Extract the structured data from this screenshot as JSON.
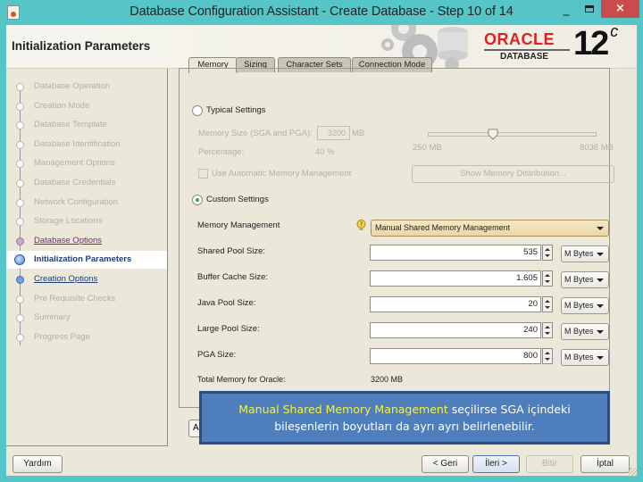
{
  "window": {
    "title": "Database Configuration Assistant - Create Database - Step 10 of 14",
    "minimize_glyph": "_",
    "close_glyph": "×",
    "icon": "java-app-icon"
  },
  "header": {
    "page_title": "Initialization Parameters",
    "brand_name": "ORACLE",
    "brand_sub": "DATABASE",
    "version": "12",
    "version_suffix": "c"
  },
  "steps": [
    {
      "label": "Database Operation",
      "state": "disabled"
    },
    {
      "label": "Creation Mode",
      "state": "disabled"
    },
    {
      "label": "Database Template",
      "state": "disabled"
    },
    {
      "label": "Database Identification",
      "state": "disabled"
    },
    {
      "label": "Management Options",
      "state": "disabled"
    },
    {
      "label": "Database Credentials",
      "state": "disabled"
    },
    {
      "label": "Network Configuration",
      "state": "disabled"
    },
    {
      "label": "Storage Locations",
      "state": "disabled"
    },
    {
      "label": "Database Options",
      "state": "visited"
    },
    {
      "label": "Initialization Parameters",
      "state": "current"
    },
    {
      "label": "Creation Options",
      "state": "link"
    },
    {
      "label": "Pre Requisite Checks",
      "state": "disabled"
    },
    {
      "label": "Summary",
      "state": "disabled"
    },
    {
      "label": "Progress Page",
      "state": "disabled"
    }
  ],
  "tabs": [
    {
      "label": "Memory",
      "active": true
    },
    {
      "label": "Sizing",
      "active": false
    },
    {
      "label": "Character Sets",
      "active": false
    },
    {
      "label": "Connection Mode",
      "active": false
    }
  ],
  "memory": {
    "typical_settings_label": "Typical Settings",
    "typical_selected": false,
    "memory_size_label": "Memory Size (SGA and PGA):",
    "memory_size_value": "3200",
    "memory_size_unit": "MB",
    "percentage_label": "Percentage:",
    "percentage_value": "40 %",
    "slider_min_label": "250 MB",
    "slider_max_label": "8038 MB",
    "slider_position_fraction": 0.38,
    "use_amm_label": "Use Automatic Memory Management",
    "use_amm_checked": false,
    "show_distribution_label": "Show Memory Distribution...",
    "custom_settings_label": "Custom Settings",
    "custom_selected": true,
    "memory_management_label": "Memory Management",
    "memory_management_value": "Manual Shared Memory Management",
    "pools": [
      {
        "label": "Shared Pool Size:",
        "value": "535",
        "unit": "M Bytes"
      },
      {
        "label": "Buffer Cache Size:",
        "value": "1.605",
        "unit": "M Bytes"
      },
      {
        "label": "Java Pool Size:",
        "value": "20",
        "unit": "M Bytes"
      },
      {
        "label": "Large Pool Size:",
        "value": "240",
        "unit": "M Bytes"
      },
      {
        "label": "PGA Size:",
        "value": "800",
        "unit": "M Bytes"
      }
    ],
    "total_label": "Total Memory for Oracle:",
    "total_value": "3200 MB"
  },
  "hidden_button_label": "A",
  "callout": {
    "highlight": "Manual Shared Memory Management",
    "text_line1_rest": " seçilirse SGA içindeki",
    "text_line2": "bileşenlerin boyutları da ayrı ayrı belirlenebilir."
  },
  "footer": {
    "help_label": "Yardım",
    "back_label": "< Geri",
    "next_label": "İleri >",
    "finish_label": "Bitir",
    "cancel_label": "İptal"
  },
  "colors": {
    "window_frame": "#55c5c8",
    "close_button": "#c94b4b",
    "callout_bg": "#4f7ebc",
    "callout_highlight": "#f5f33d",
    "oracle_red": "#e0221c"
  }
}
